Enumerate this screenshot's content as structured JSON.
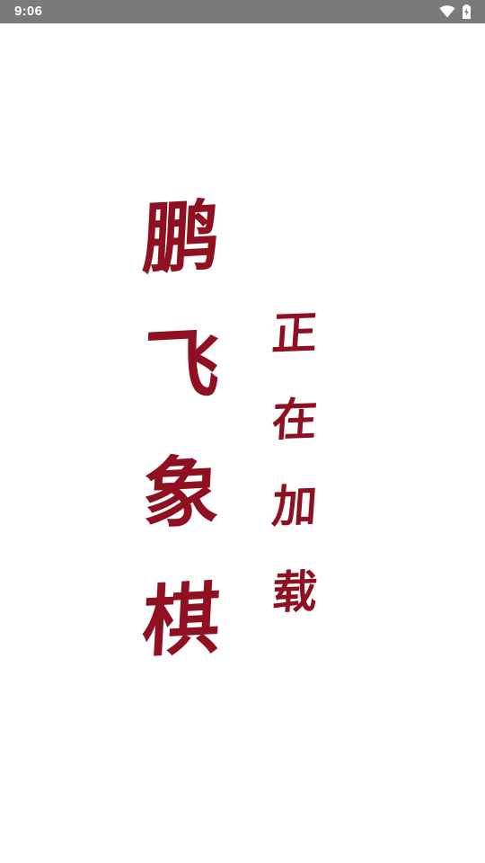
{
  "status_bar": {
    "time": "9:06",
    "icons": [
      "wifi-icon",
      "battery-charging-icon"
    ],
    "background_color": "#7a7a7a"
  },
  "splash": {
    "title_chars": [
      "鹏",
      "飞",
      "象",
      "棋"
    ],
    "loading_chars": [
      "正",
      "在",
      "加",
      "载"
    ],
    "text_color": "#8f1020",
    "background_color": "#ffffff"
  }
}
